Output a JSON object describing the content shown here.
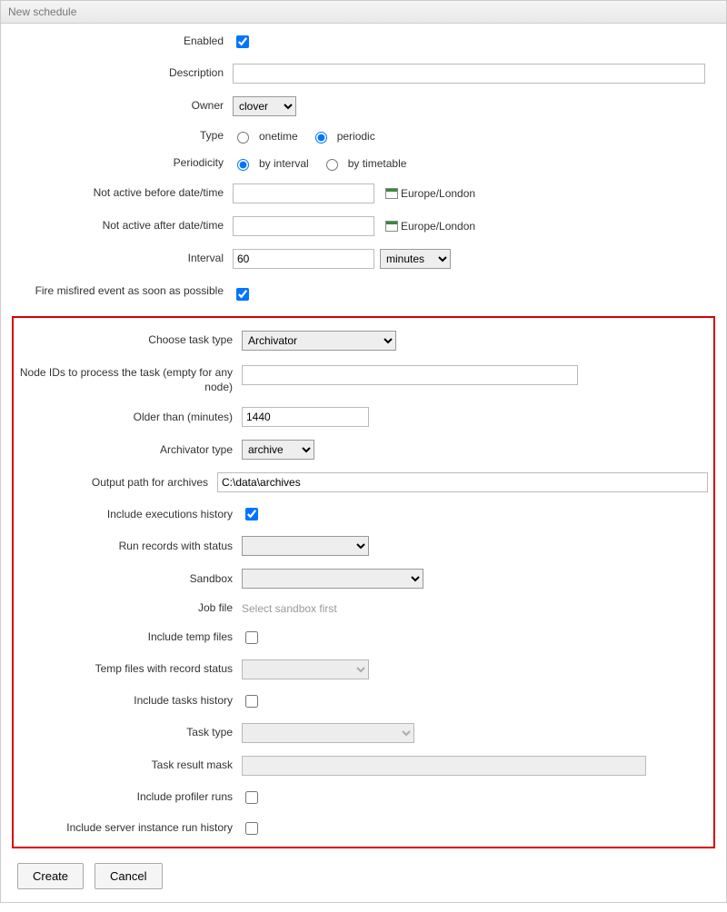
{
  "title": "New schedule",
  "labels": {
    "enabled": "Enabled",
    "description": "Description",
    "owner": "Owner",
    "type": "Type",
    "periodicity": "Periodicity",
    "not_before": "Not active before date/time",
    "not_after": "Not active after date/time",
    "interval": "Interval",
    "fire_misfired": "Fire misfired event as soon as possible",
    "choose_task_type": "Choose task type",
    "node_ids": "Node IDs to process the task (empty for any node)",
    "older_than": "Older than (minutes)",
    "archivator_type": "Archivator type",
    "output_path": "Output path for archives",
    "include_exec_history": "Include executions history",
    "run_records_status": "Run records with status",
    "sandbox": "Sandbox",
    "job_file": "Job file",
    "include_temp": "Include temp files",
    "temp_files_status": "Temp files with record status",
    "include_tasks_history": "Include tasks history",
    "task_type": "Task type",
    "task_result_mask": "Task result mask",
    "include_profiler": "Include profiler runs",
    "include_server_history": "Include server instance run history"
  },
  "values": {
    "enabled": true,
    "description": "",
    "owner": "clover",
    "type_onetime": "onetime",
    "type_periodic": "periodic",
    "type_selected": "periodic",
    "periodicity_interval_label": "by interval",
    "periodicity_timetable_label": "by timetable",
    "periodicity_selected": "by interval",
    "not_before_value": "",
    "not_after_value": "",
    "timezone": "Europe/London",
    "interval_value": "60",
    "interval_unit": "minutes",
    "fire_misfired": true,
    "task_type_selected": "Archivator",
    "node_ids": "",
    "older_than": "1440",
    "archivator_type": "archive",
    "output_path": "C:\\data\\archives",
    "include_exec_history": true,
    "run_records_status": "",
    "sandbox": "",
    "job_file_hint": "Select sandbox first",
    "include_temp": false,
    "temp_files_status": "",
    "include_tasks_history": false,
    "task_type_inner": "",
    "task_result_mask": "",
    "include_profiler": false,
    "include_server_history": false
  },
  "buttons": {
    "create": "Create",
    "cancel": "Cancel"
  }
}
